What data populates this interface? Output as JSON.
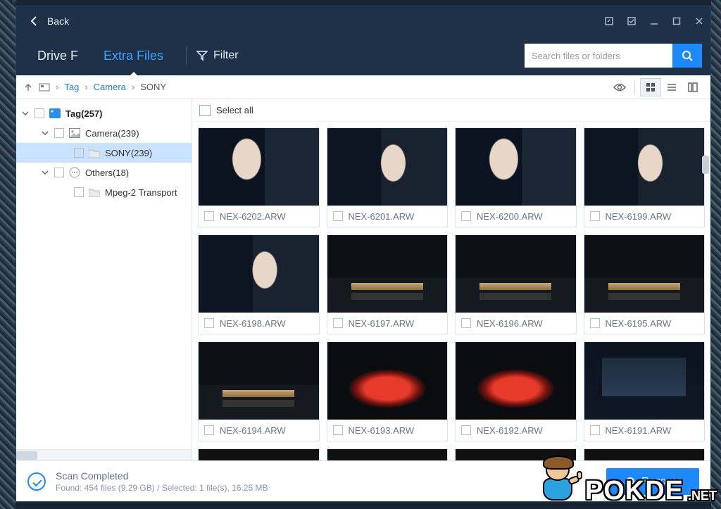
{
  "title_bar": {
    "back_label": "Back"
  },
  "nav": {
    "tabs": [
      {
        "id": "drive-f",
        "label": "Drive F",
        "active": false
      },
      {
        "id": "extra-files",
        "label": "Extra Files",
        "active": true
      }
    ],
    "filter_label": "Filter"
  },
  "search": {
    "placeholder": "Search files or folders"
  },
  "breadcrumb": {
    "items": [
      {
        "id": "tag",
        "label": "Tag"
      },
      {
        "id": "camera",
        "label": "Camera"
      },
      {
        "id": "sony",
        "label": "SONY"
      }
    ]
  },
  "sidebar": {
    "nodes": [
      {
        "id": "tag",
        "depth": 0,
        "expanded": true,
        "checkbox": true,
        "icon": "tag-icon",
        "label": "Tag(257)",
        "bold": true,
        "selected": false
      },
      {
        "id": "camera",
        "depth": 1,
        "expanded": true,
        "checkbox": true,
        "icon": "image-icon",
        "label": "Camera(239)",
        "bold": false,
        "selected": false
      },
      {
        "id": "sony",
        "depth": 2,
        "expanded": null,
        "checkbox": true,
        "icon": "folder-icon",
        "label": "SONY(239)",
        "bold": false,
        "selected": true
      },
      {
        "id": "others",
        "depth": 1,
        "expanded": true,
        "checkbox": true,
        "icon": "dots-icon",
        "label": "Others(18)",
        "bold": false,
        "selected": false
      },
      {
        "id": "mpeg2",
        "depth": 2,
        "expanded": null,
        "checkbox": true,
        "icon": "folder-icon",
        "label": "Mpeg-2 Transport",
        "bold": false,
        "selected": false
      }
    ]
  },
  "content": {
    "select_all_label": "Select all",
    "files": [
      {
        "name": "NEX-6202.ARW",
        "photo": "p-model"
      },
      {
        "name": "NEX-6201.ARW",
        "photo": "p-model2"
      },
      {
        "name": "NEX-6200.ARW",
        "photo": "p-model"
      },
      {
        "name": "NEX-6199.ARW",
        "photo": "p-model2"
      },
      {
        "name": "NEX-6198.ARW",
        "photo": "p-model2"
      },
      {
        "name": "NEX-6197.ARW",
        "photo": "p-hw"
      },
      {
        "name": "NEX-6196.ARW",
        "photo": "p-hw"
      },
      {
        "name": "NEX-6195.ARW",
        "photo": "p-hw"
      },
      {
        "name": "NEX-6194.ARW",
        "photo": "p-hw"
      },
      {
        "name": "NEX-6193.ARW",
        "photo": "p-red"
      },
      {
        "name": "NEX-6192.ARW",
        "photo": "p-red"
      },
      {
        "name": "NEX-6191.ARW",
        "photo": "p-pres"
      }
    ]
  },
  "status": {
    "title": "Scan Completed",
    "detail": "Found: 454 files (9.29 GB) / Selected: 1 file(s), 16.25 MB",
    "recover_label": "Recover"
  },
  "watermark": {
    "main": "POKDE",
    "suffix": ".NET"
  }
}
